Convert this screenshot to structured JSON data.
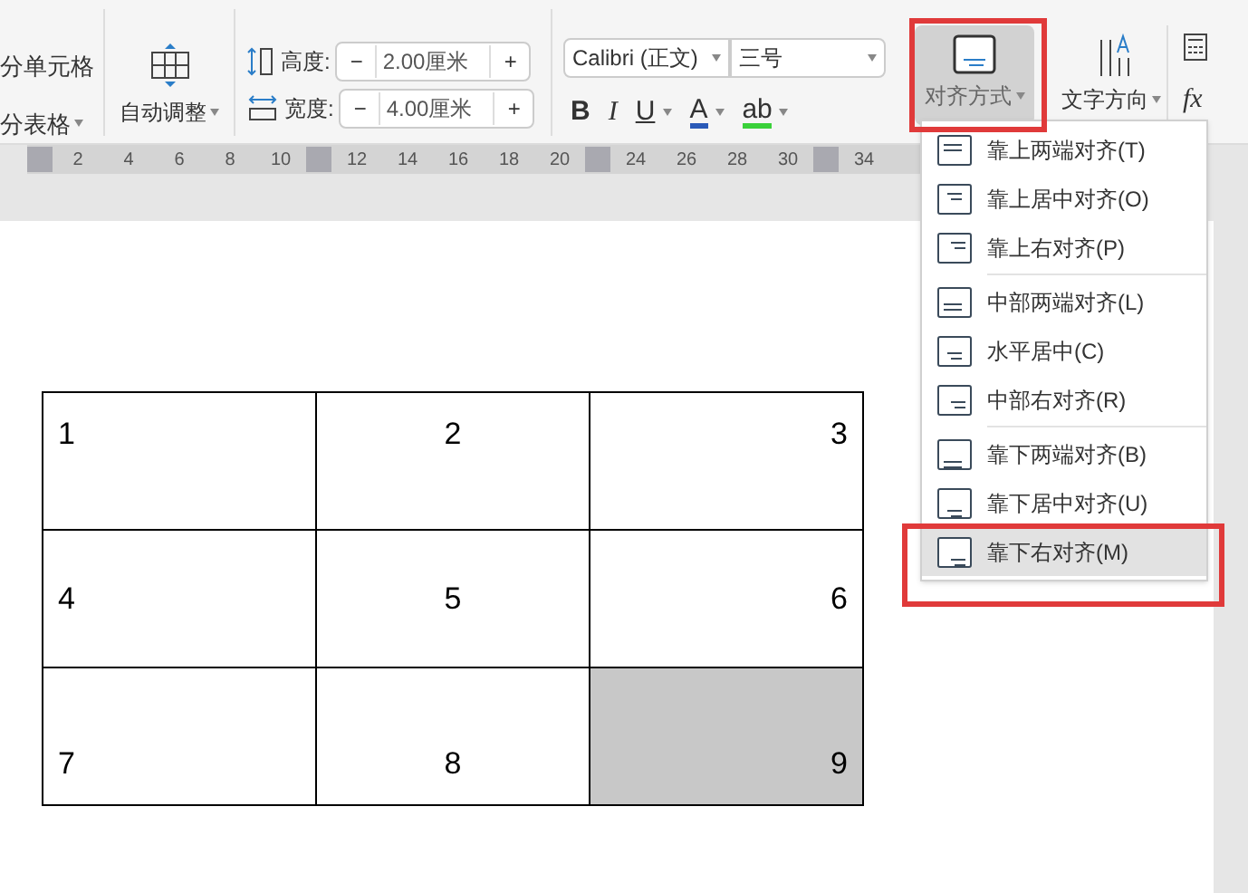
{
  "ribbon": {
    "split_cells": "分单元格",
    "split_table": "分表格",
    "auto_fit": "自动调整",
    "height": {
      "label": "高度:",
      "value": "2.00厘米",
      "minus": "−",
      "plus": "+"
    },
    "width": {
      "label": "宽度:",
      "value": "4.00厘米",
      "minus": "−",
      "plus": "+"
    },
    "font": {
      "family": "Calibri (正文)",
      "size": "三号"
    },
    "format_buttons": [
      {
        "kind": "bold",
        "label": "B"
      },
      {
        "kind": "italic",
        "label": "I"
      },
      {
        "kind": "underline",
        "label": "U"
      },
      {
        "kind": "font_color",
        "label": "A"
      },
      {
        "kind": "highlight",
        "label": "ab"
      }
    ],
    "align_button": {
      "label": "对齐方式",
      "selected": true
    },
    "text_direction": "文字方向",
    "formula": "fx"
  },
  "ruler": [
    {
      "kind": "marker"
    },
    {
      "kind": "number",
      "label": "2"
    },
    {
      "kind": "number",
      "label": "4"
    },
    {
      "kind": "number",
      "label": "6"
    },
    {
      "kind": "number",
      "label": "8"
    },
    {
      "kind": "number",
      "label": "10"
    },
    {
      "kind": "marker"
    },
    {
      "kind": "number",
      "label": "12"
    },
    {
      "kind": "number",
      "label": "14"
    },
    {
      "kind": "number",
      "label": "16"
    },
    {
      "kind": "number",
      "label": "18"
    },
    {
      "kind": "number",
      "label": "20"
    },
    {
      "kind": "marker"
    },
    {
      "kind": "number",
      "label": "24"
    },
    {
      "kind": "number",
      "label": "26"
    },
    {
      "kind": "number",
      "label": "28"
    },
    {
      "kind": "number",
      "label": "30"
    },
    {
      "kind": "marker"
    },
    {
      "kind": "number",
      "label": "34"
    }
  ],
  "menu": {
    "groups": [
      [
        {
          "label": "靠上两端对齐(T)",
          "kind": "topleft",
          "selected": false
        },
        {
          "label": "靠上居中对齐(O)",
          "kind": "topcenter",
          "selected": false
        },
        {
          "label": "靠上右对齐(P)",
          "kind": "topright",
          "selected": false
        }
      ],
      [
        {
          "label": "中部两端对齐(L)",
          "kind": "middleleft",
          "selected": false
        },
        {
          "label": "水平居中(C)",
          "kind": "middlecenter",
          "selected": false
        },
        {
          "label": "中部右对齐(R)",
          "kind": "middleright",
          "selected": false
        }
      ],
      [
        {
          "label": "靠下两端对齐(B)",
          "kind": "bottomleft",
          "selected": false
        },
        {
          "label": "靠下居中对齐(U)",
          "kind": "bottomcenter",
          "selected": false
        },
        {
          "label": "靠下右对齐(M)",
          "kind": "bottomright",
          "selected": true
        }
      ]
    ]
  },
  "table": {
    "rows": [
      [
        {
          "text": "1",
          "kind": "topleft",
          "selected": false
        },
        {
          "text": "2",
          "kind": "topcenter",
          "selected": false
        },
        {
          "text": "3",
          "kind": "topright",
          "selected": false
        }
      ],
      [
        {
          "text": "4",
          "kind": "middleleft",
          "selected": false
        },
        {
          "text": "5",
          "kind": "middlecenter",
          "selected": false
        },
        {
          "text": "6",
          "kind": "middleright",
          "selected": false
        }
      ],
      [
        {
          "text": "7",
          "kind": "bottomleft",
          "selected": false
        },
        {
          "text": "8",
          "kind": "bottomcenter",
          "selected": false
        },
        {
          "text": "9",
          "kind": "bottomright",
          "selected": true
        }
      ]
    ]
  }
}
